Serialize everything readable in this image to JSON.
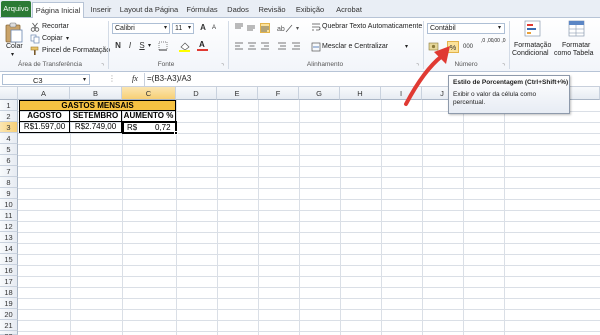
{
  "tabs": [
    "Arquivo",
    "Página Inicial",
    "Inserir",
    "Layout da Página",
    "Fórmulas",
    "Dados",
    "Revisão",
    "Exibição",
    "Acrobat"
  ],
  "ribbon": {
    "clipboard": {
      "paste": "Colar",
      "cut": "Recortar",
      "copy": "Copiar",
      "format_painter": "Pincel de Formatação",
      "group": "Área de Transferência"
    },
    "font": {
      "name": "Calibri",
      "size": "11",
      "bold": "N",
      "italic": "I",
      "underline": "S",
      "grow": "A",
      "shrink": "A",
      "color_letter": "A",
      "group": "Fonte"
    },
    "alignment": {
      "wrap": "Quebrar Texto Automaticamente",
      "merge": "Mesclar e Centralizar",
      "group": "Alinhamento"
    },
    "number": {
      "format": "Contábil",
      "percent": "%",
      "thousands": "000",
      "inc_decimal": ",0 ,00",
      "dec_decimal": ",00 ,0",
      "group": "Número"
    },
    "styles": {
      "conditional": "Formatação",
      "conditional2": "Condicional",
      "as_table": "Formatar",
      "as_table2": "como Tabela"
    }
  },
  "formula_bar": {
    "name_box": "C3",
    "fx": "fx",
    "formula": "=(B3-A3)/A3"
  },
  "tooltip": {
    "title": "Estilo de Porcentagem (Ctrl+Shift+%)",
    "body": "Exibir o valor da célula como percentual."
  },
  "grid": {
    "columns": [
      "A",
      "B",
      "C",
      "D",
      "E",
      "F",
      "G",
      "H",
      "I",
      "J",
      "K",
      "L"
    ],
    "rows": [
      "1",
      "2",
      "3",
      "4",
      "5",
      "6",
      "7",
      "8",
      "9",
      "10",
      "11",
      "12",
      "13",
      "14",
      "15",
      "16",
      "17",
      "18",
      "19",
      "20",
      "21",
      "22"
    ],
    "title": "GASTOS MENSAIS",
    "headers": [
      "AGOSTO",
      "SETEMBRO",
      "AUMENTO %"
    ],
    "values": [
      "R$1.597,00",
      "R$2.749,00",
      "R$",
      "0,72"
    ]
  },
  "colors": {
    "header_fill": "#f6c242",
    "file_tab": "#2b7a34",
    "arrow": "#e03a33",
    "selection": "#f7cf75"
  }
}
